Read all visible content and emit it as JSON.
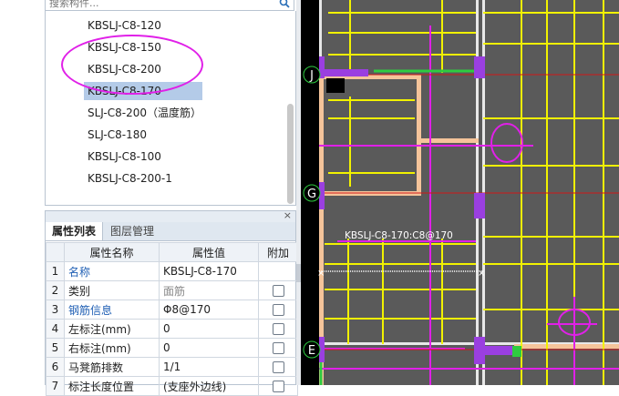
{
  "search": {
    "placeholder": "搜索构件..."
  },
  "tree": {
    "items": [
      {
        "label": "KBSLJ-C8-120",
        "selected": false
      },
      {
        "label": "KBSLJ-C8-150",
        "selected": false
      },
      {
        "label": "KBSLJ-C8-200",
        "selected": false
      },
      {
        "label": "KBSLJ-C8-170",
        "selected": true
      },
      {
        "label": "SLJ-C8-200（温度筋）",
        "selected": false
      },
      {
        "label": "SLJ-C8-180",
        "selected": false
      },
      {
        "label": "KBSLJ-C8-100",
        "selected": false
      },
      {
        "label": "KBSLJ-C8-200-1",
        "selected": false
      }
    ]
  },
  "panel": {
    "close_label": "×",
    "tabs": [
      "属性列表",
      "图层管理"
    ],
    "table": {
      "headers": [
        "",
        "属性名称",
        "属性值",
        "附加"
      ],
      "rows": [
        {
          "num": "1",
          "name": "名称",
          "value": "KBSLJ-C8-170",
          "name_link": true,
          "checkbox": false
        },
        {
          "num": "2",
          "name": "类别",
          "value": "面筋",
          "value_gray": true,
          "checkbox": true
        },
        {
          "num": "3",
          "name": "钢筋信息",
          "value": "Φ8@170",
          "name_link": true,
          "checkbox": true
        },
        {
          "num": "4",
          "name": "左标注(mm)",
          "value": "0",
          "checkbox": true
        },
        {
          "num": "5",
          "name": "右标注(mm)",
          "value": "0",
          "checkbox": true
        },
        {
          "num": "6",
          "name": "马凳筋排数",
          "value": "1/1",
          "checkbox": true
        },
        {
          "num": "7",
          "name": "标注长度位置",
          "value": "(支座外边线)",
          "checkbox": true
        }
      ]
    }
  },
  "canvas": {
    "axis_labels": [
      "J",
      "G",
      "E"
    ],
    "rebar_label": "KBSLJ-C8-170:C8@170"
  },
  "colors": {
    "canvas_bg": "#5a5a5a",
    "yellow": "#f2f200",
    "magenta": "#e020e8",
    "purple": "#9a3fe0",
    "green": "#2ecc40",
    "peach": "#f5c49a",
    "red": "#d01818",
    "selection": "#b4cbe8",
    "link_blue": "#1f5fb4"
  }
}
